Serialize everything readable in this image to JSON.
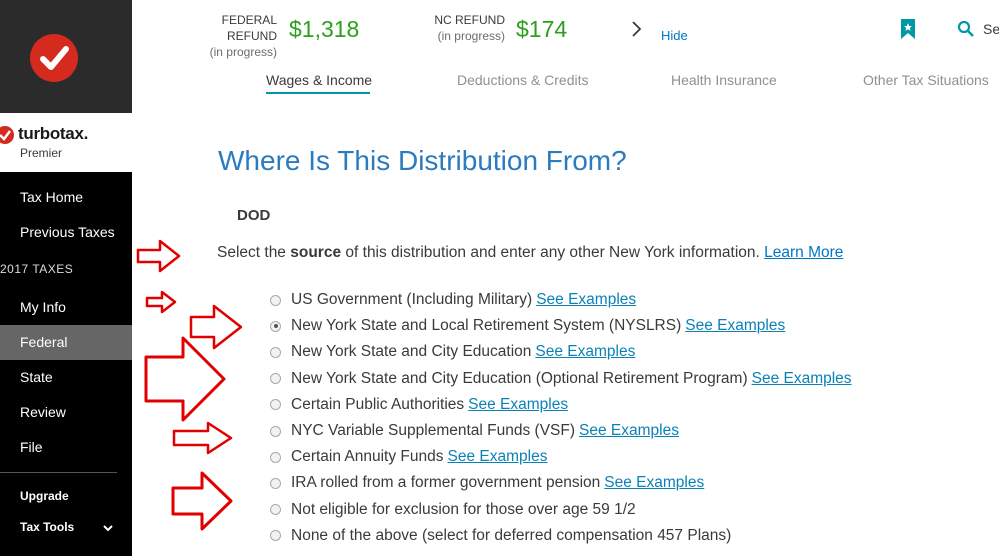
{
  "sidebar": {
    "brand_name": "turbotax.",
    "brand_tier": "Premier",
    "nav": [
      {
        "label": "Tax Home"
      },
      {
        "label": "Previous Taxes"
      },
      {
        "label": "My Info"
      },
      {
        "label": "Federal"
      },
      {
        "label": "State"
      },
      {
        "label": "Review"
      },
      {
        "label": "File"
      }
    ],
    "section_label": "2017 TAXES",
    "upgrade": "Upgrade",
    "tax_tools": "Tax Tools",
    "active": "Federal"
  },
  "refunds": {
    "federal_label": "FEDERAL REFUND",
    "federal_status": "(in progress)",
    "federal_amount": "$1,318",
    "nc_label": "NC REFUND",
    "nc_status": "(in progress)",
    "nc_amount": "$174",
    "hide": "Hide",
    "search_partial": "Se"
  },
  "tabs": [
    {
      "label": "Wages & Income",
      "active": true
    },
    {
      "label": "Deductions & Credits"
    },
    {
      "label": "Health Insurance"
    },
    {
      "label": "Other Tax Situations"
    }
  ],
  "main": {
    "title": "Where Is This Distribution From?",
    "subtitle": "DOD",
    "instr_pre": "Select the ",
    "instr_bold": "source",
    "instr_post": " of this distribution and enter any other New York information. ",
    "learn_more": "Learn More",
    "options": [
      {
        "label": "US Government (Including Military)",
        "link": "See Examples",
        "selected": false
      },
      {
        "label": "New York State and Local Retirement System (NYSLRS)",
        "link": "See Examples",
        "selected": true
      },
      {
        "label": "New York State and City Education",
        "link": "See Examples",
        "selected": false
      },
      {
        "label": "New York State and City Education (Optional Retirement Program)",
        "link": "See Examples",
        "selected": false
      },
      {
        "label": "Certain Public Authorities",
        "link": "See Examples",
        "selected": false
      },
      {
        "label": "NYC Variable Supplemental Funds (VSF)",
        "link": "See Examples",
        "selected": false
      },
      {
        "label": "Certain Annuity Funds",
        "link": "See Examples",
        "selected": false
      },
      {
        "label": "IRA rolled from a former government pension",
        "link": "See Examples",
        "selected": false
      },
      {
        "label": "Not eligible for exclusion for those over age 59 1/2",
        "link": "",
        "selected": false
      },
      {
        "label": "None of the above (select for deferred compensation 457 Plans)",
        "link": "",
        "selected": false
      }
    ]
  },
  "colors": {
    "accent": "#2b7bbf",
    "refund_green": "#2ca01c",
    "brand_red": "#d52b1e",
    "annotation_red": "#e00000"
  },
  "icons": [
    "checkmark-logo-icon",
    "chevron-right-icon",
    "bookmark-icon",
    "search-icon",
    "chevron-down-icon",
    "red-arrow-annotation"
  ]
}
